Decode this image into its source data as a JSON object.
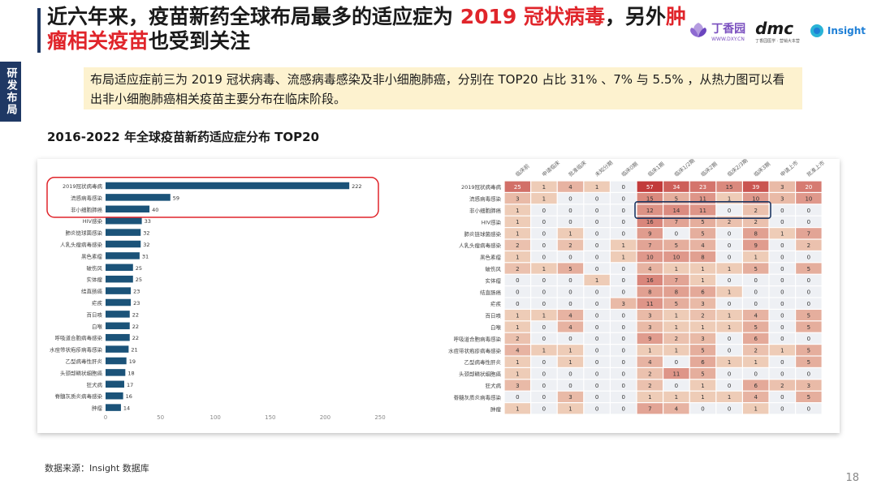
{
  "header": {
    "title_part1": "近六年来，疫苗新药全球布局最多的适应症为 ",
    "title_red1": "2019 冠状病毒",
    "title_part2": "，另外",
    "title_red2": "肿瘤相关疫苗",
    "title_part3": "也受到关注",
    "side_tab": "研发布局",
    "summary": "布局适应症前三为 2019 冠状病毒、流感病毒感染及非小细胞肺癌，分别在 TOP20 占比 31% 、7% 与 5.5% ，从热力图可以看出非小细胞肺癌相关疫苗主要分布在临床阶段。",
    "chart_subtitle": "2016-2022 年全球疫苗新药适应症分布 TOP20"
  },
  "logos": {
    "dxy_name": "丁香园",
    "dxy_sub": "WWW.DXY.CN",
    "dmc_name": "dmc",
    "dmc_sub": "丁香园医学 · 营销大本营",
    "insight_name": "Insight"
  },
  "footer": {
    "source": "数据来源：Insight 数据库",
    "page_number": "18"
  },
  "colors": {
    "accent_navy": "#1f3864",
    "bar_color": "#1b5379",
    "highlight_red": "#e0252b",
    "highlight_navy": "#1f3864",
    "heat_low": "#f7e8cf",
    "heat_high": "#c23a3a",
    "heat_zero": "#eef0f4"
  },
  "chart_data": [
    {
      "type": "bar",
      "orientation": "horizontal",
      "categories": [
        "2019冠状病毒病",
        "流感病毒感染",
        "非小细胞肺癌",
        "HIV感染",
        "肺炎链球菌感染",
        "人乳头瘤病毒感染",
        "黑色素瘤",
        "破伤风",
        "实体瘤",
        "结直肠癌",
        "疟疾",
        "百日咳",
        "白喉",
        "呼吸道合胞病毒感染",
        "水痘带状疱疹病毒感染",
        "乙型病毒性肝炎",
        "头颈部鳞状细胞癌",
        "狂犬病",
        "脊髓灰质炎病毒感染",
        "肿瘤"
      ],
      "values": [
        222,
        59,
        40,
        33,
        32,
        32,
        31,
        25,
        25,
        23,
        23,
        22,
        22,
        22,
        21,
        19,
        18,
        17,
        16,
        14
      ],
      "xlim": [
        0,
        250
      ],
      "xticks": [
        0,
        50,
        100,
        150,
        200,
        250
      ],
      "highlighted": [
        "2019冠状病毒病",
        "流感病毒感染",
        "非小细胞肺癌"
      ],
      "grid": false
    },
    {
      "type": "heatmap",
      "columns": [
        "临床前",
        "申请临床",
        "批准临床",
        "未知分期",
        "临床0期",
        "临床1期",
        "临床1/2期",
        "临床2期",
        "临床2/3期",
        "临床3期",
        "申请上市",
        "批准上市"
      ],
      "rows": [
        "2019冠状病毒病",
        "流感病毒感染",
        "非小细胞肺癌",
        "HIV感染",
        "肺炎链球菌感染",
        "人乳头瘤病毒感染",
        "黑色素瘤",
        "破伤风",
        "实体瘤",
        "结直肠癌",
        "疟疾",
        "百日咳",
        "白喉",
        "呼吸道合胞病毒感染",
        "水痘带状疱疹病毒感染",
        "乙型病毒性肝炎",
        "头颈部鳞状细胞癌",
        "狂犬病",
        "脊髓灰质炎病毒感染",
        "肿瘤"
      ],
      "values": [
        [
          25,
          1,
          4,
          1,
          0,
          57,
          34,
          23,
          15,
          39,
          3,
          20
        ],
        [
          3,
          1,
          0,
          0,
          0,
          15,
          5,
          11,
          1,
          10,
          3,
          10
        ],
        [
          1,
          0,
          0,
          0,
          0,
          12,
          14,
          11,
          0,
          2,
          0,
          0
        ],
        [
          1,
          0,
          0,
          0,
          0,
          16,
          7,
          5,
          2,
          2,
          0,
          0
        ],
        [
          1,
          0,
          1,
          0,
          0,
          9,
          0,
          5,
          0,
          8,
          1,
          7
        ],
        [
          2,
          0,
          2,
          0,
          1,
          7,
          5,
          4,
          0,
          9,
          0,
          2
        ],
        [
          1,
          0,
          0,
          0,
          1,
          10,
          10,
          8,
          0,
          1,
          0,
          0
        ],
        [
          2,
          1,
          5,
          0,
          0,
          4,
          1,
          1,
          1,
          5,
          0,
          5
        ],
        [
          0,
          0,
          0,
          1,
          0,
          16,
          7,
          1,
          0,
          0,
          0,
          0
        ],
        [
          0,
          0,
          0,
          0,
          0,
          8,
          8,
          6,
          1,
          0,
          0,
          0
        ],
        [
          0,
          0,
          0,
          0,
          3,
          11,
          5,
          3,
          0,
          0,
          0,
          0
        ],
        [
          1,
          1,
          4,
          0,
          0,
          3,
          1,
          2,
          1,
          4,
          0,
          5
        ],
        [
          1,
          0,
          4,
          0,
          0,
          3,
          1,
          1,
          1,
          5,
          0,
          5
        ],
        [
          2,
          0,
          0,
          0,
          0,
          9,
          2,
          3,
          0,
          6,
          0,
          0
        ],
        [
          4,
          1,
          1,
          0,
          0,
          1,
          1,
          5,
          0,
          2,
          1,
          5
        ],
        [
          1,
          0,
          1,
          0,
          0,
          4,
          0,
          6,
          1,
          1,
          0,
          5
        ],
        [
          1,
          0,
          0,
          0,
          0,
          2,
          11,
          5,
          0,
          0,
          0,
          0
        ],
        [
          3,
          0,
          0,
          0,
          0,
          2,
          0,
          1,
          0,
          6,
          2,
          3
        ],
        [
          0,
          0,
          3,
          0,
          0,
          1,
          1,
          1,
          1,
          4,
          0,
          5
        ],
        [
          1,
          0,
          1,
          0,
          0,
          7,
          4,
          0,
          0,
          1,
          0,
          0
        ]
      ],
      "highlighted_rows": [
        "非小细胞肺癌"
      ],
      "highlighted_columns": [
        "临床1期",
        "临床1/2期",
        "临床2期",
        "临床2/3期",
        "临床3期"
      ]
    }
  ]
}
